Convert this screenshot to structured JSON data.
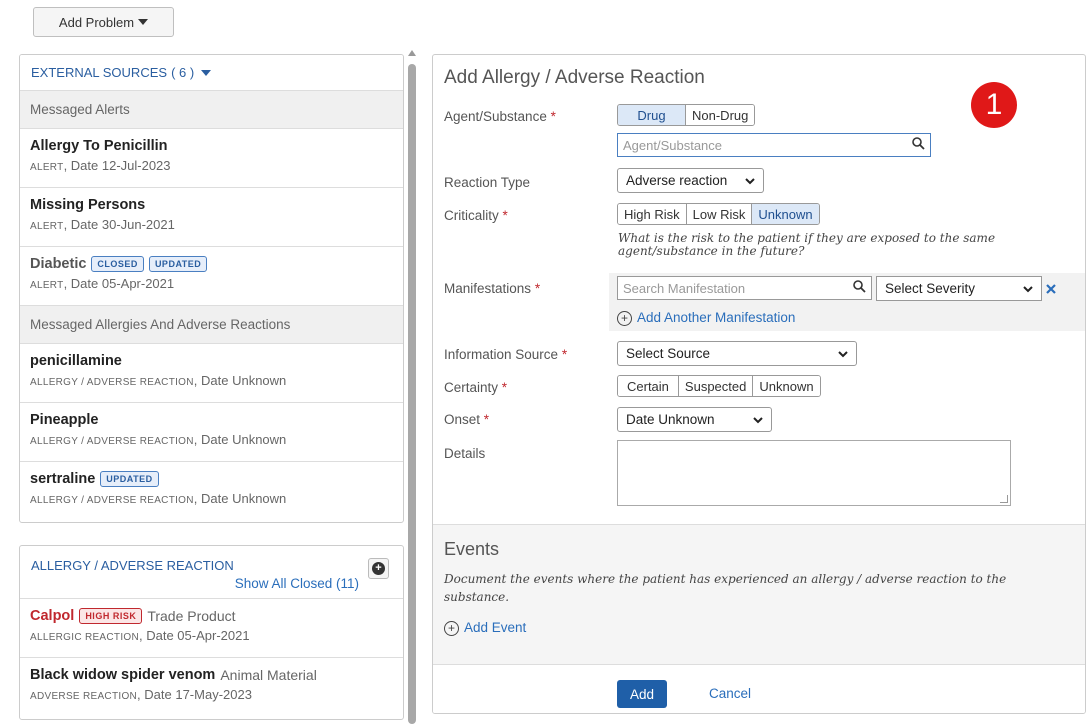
{
  "toolbar": {
    "add_problem_label": "Add Problem"
  },
  "external_sources": {
    "title": "EXTERNAL SOURCES",
    "count": "( 6 )",
    "alerts_section": "Messaged Alerts",
    "alerts": [
      {
        "title": "Allergy To Penicillin",
        "kind": "Alert",
        "date": ", Date 12-Jul-2023"
      },
      {
        "title": "Missing Persons",
        "kind": "Alert",
        "date": ", Date 30-Jun-2021"
      },
      {
        "title": "Diabetic",
        "badge1": "Closed",
        "badge2": "Updated",
        "kind": "Alert",
        "date": ", Date 05-Apr-2021"
      }
    ],
    "allergies_section": "Messaged Allergies And Adverse Reactions",
    "allergies": [
      {
        "title": "penicillamine",
        "kind": "Allergy / Adverse Reaction",
        "date": ", Date Unknown"
      },
      {
        "title": "Pineapple",
        "kind": "Allergy / Adverse Reaction",
        "date": ", Date Unknown"
      },
      {
        "title": "sertraline",
        "badge": "Updated",
        "kind": "Allergy / Adverse Reaction",
        "date": ", Date Unknown"
      }
    ]
  },
  "allergy_panel": {
    "title": "ALLERGY / ADVERSE REACTION",
    "show_closed": "Show All Closed (11)",
    "items": [
      {
        "title": "Calpol",
        "badge": "High Risk",
        "type": "Trade Product",
        "kind": "Allergic Reaction",
        "date": ", Date 05-Apr-2021"
      },
      {
        "title": "Black widow spider venom",
        "type": "Animal Material",
        "kind": "Adverse Reaction",
        "date": ", Date 17-May-2023"
      }
    ]
  },
  "form": {
    "title": "Add Allergy / Adverse Reaction",
    "step_number": "1",
    "agent_label": "Agent/Substance",
    "agent_options": [
      "Drug",
      "Non-Drug"
    ],
    "agent_placeholder": "Agent/Substance",
    "reaction_type_label": "Reaction Type",
    "reaction_type_value": "Adverse reaction",
    "criticality_label": "Criticality",
    "criticality_options": [
      "High Risk",
      "Low Risk",
      "Unknown"
    ],
    "criticality_help": "What is the risk to the patient if they are exposed to the same agent/substance in the future?",
    "manifestations_label": "Manifestations",
    "manifestation_placeholder": "Search Manifestation",
    "severity_value": "Select Severity",
    "add_manifestation": "Add Another Manifestation",
    "info_source_label": "Information Source",
    "info_source_value": "Select Source",
    "certainty_label": "Certainty",
    "certainty_options": [
      "Certain",
      "Suspected",
      "Unknown"
    ],
    "onset_label": "Onset",
    "onset_value": "Date Unknown",
    "details_label": "Details",
    "required_mark": "*",
    "events_title": "Events",
    "events_desc": "Document the events where the patient has experienced an allergy / adverse reaction to the substance.",
    "add_event": "Add Event",
    "add_button": "Add",
    "cancel_link": "Cancel"
  },
  "colors": {
    "accent": "#1f5fa8",
    "link": "#2a6ebb",
    "required": "#c0282e",
    "step_badge": "#e01818"
  }
}
